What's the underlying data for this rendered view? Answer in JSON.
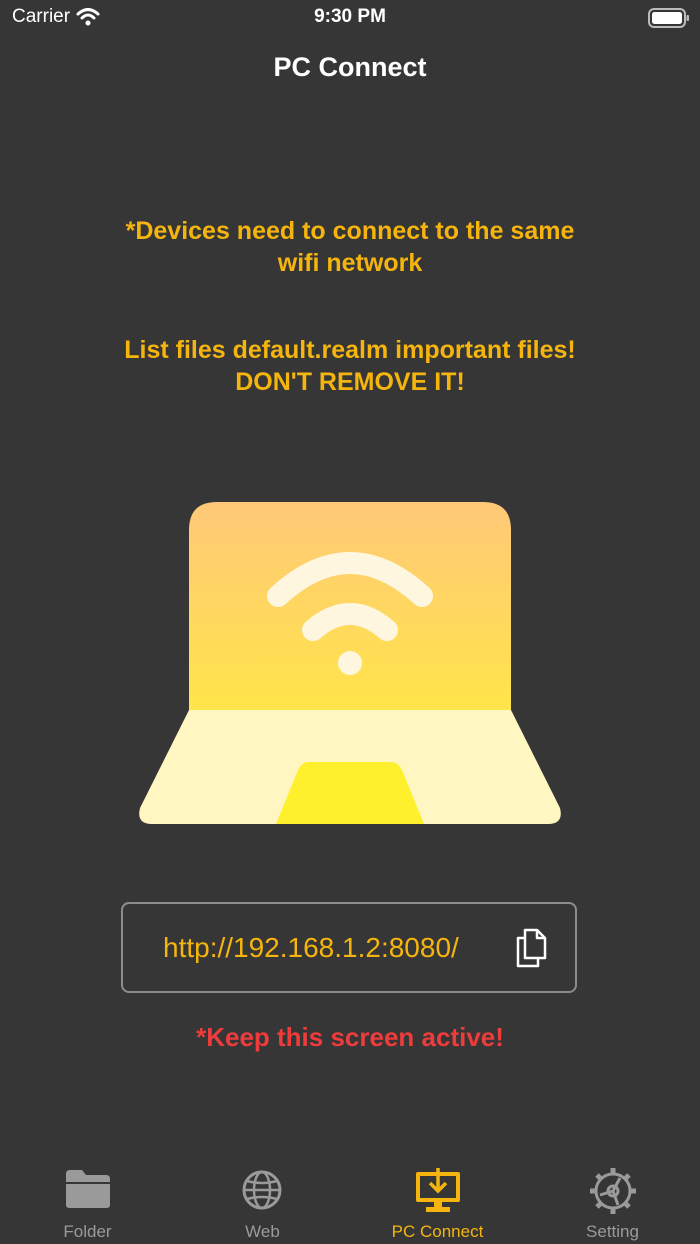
{
  "status_bar": {
    "carrier": "Carrier",
    "time": "9:30 PM"
  },
  "nav": {
    "title": "PC Connect"
  },
  "notices": {
    "wifi_line1": "*Devices need to connect to the same",
    "wifi_line2": "wifi network",
    "realm_line1": "List files default.realm important files!",
    "realm_line2": "DON'T REMOVE IT!"
  },
  "server": {
    "url": "http://192.168.1.2:8080/"
  },
  "warning": {
    "keep_active": "*Keep this screen active!"
  },
  "tabs": [
    {
      "label": "Folder",
      "icon": "folder-icon",
      "active": false
    },
    {
      "label": "Web",
      "icon": "globe-icon",
      "active": false
    },
    {
      "label": "PC Connect",
      "icon": "monitor-download-icon",
      "active": true
    },
    {
      "label": "Setting",
      "icon": "gear-icon",
      "active": false
    }
  ],
  "colors": {
    "background": "#363636",
    "accent": "#f5b50e",
    "warning": "#ee3b3b",
    "inactive": "#9a9a9a"
  }
}
